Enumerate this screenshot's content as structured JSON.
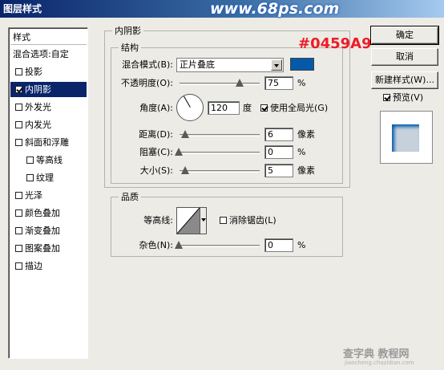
{
  "window": {
    "title": "图层样式",
    "watermark": "www.68ps.com",
    "annotation": "#0459A9",
    "footer_watermark": "查字典 教程网",
    "footer_watermark_url": "jiaocheng.chazidian.com"
  },
  "sidebar": {
    "header": "样式",
    "items": [
      {
        "label": "混合选项:自定",
        "checkbox": false
      },
      {
        "label": "投影",
        "checkbox": true,
        "checked": false
      },
      {
        "label": "内阴影",
        "checkbox": true,
        "checked": true,
        "selected": true
      },
      {
        "label": "外发光",
        "checkbox": true,
        "checked": false
      },
      {
        "label": "内发光",
        "checkbox": true,
        "checked": false
      },
      {
        "label": "斜面和浮雕",
        "checkbox": true,
        "checked": false
      },
      {
        "label": "等高线",
        "checkbox": true,
        "checked": false,
        "indent": true
      },
      {
        "label": "纹理",
        "checkbox": true,
        "checked": false,
        "indent": true
      },
      {
        "label": "光泽",
        "checkbox": true,
        "checked": false
      },
      {
        "label": "颜色叠加",
        "checkbox": true,
        "checked": false
      },
      {
        "label": "渐变叠加",
        "checkbox": true,
        "checked": false
      },
      {
        "label": "图案叠加",
        "checkbox": true,
        "checked": false
      },
      {
        "label": "描边",
        "checkbox": true,
        "checked": false
      }
    ]
  },
  "inner_shadow": {
    "group_title": "内阴影",
    "structure": {
      "title": "结构",
      "blend_mode_label": "混合模式(B):",
      "blend_mode_value": "正片叠底",
      "color": "#0459a9",
      "opacity_label": "不透明度(O):",
      "opacity_value": "75",
      "opacity_unit": "%",
      "angle_label": "角度(A):",
      "angle_value": "120",
      "angle_unit": "度",
      "global_light_label": "使用全局光(G)",
      "global_light_checked": true,
      "distance_label": "距离(D):",
      "distance_value": "6",
      "distance_unit": "像素",
      "choke_label": "阻塞(C):",
      "choke_value": "0",
      "choke_unit": "%",
      "size_label": "大小(S):",
      "size_value": "5",
      "size_unit": "像素"
    },
    "quality": {
      "title": "品质",
      "contour_label": "等高线:",
      "anti_alias_label": "消除锯齿(L)",
      "anti_alias_checked": false,
      "noise_label": "杂色(N):",
      "noise_value": "0",
      "noise_unit": "%"
    }
  },
  "buttons": {
    "ok": "确定",
    "cancel": "取消",
    "new_style": "新建样式(W)...",
    "preview_label": "预览(V)",
    "preview_checked": true
  }
}
